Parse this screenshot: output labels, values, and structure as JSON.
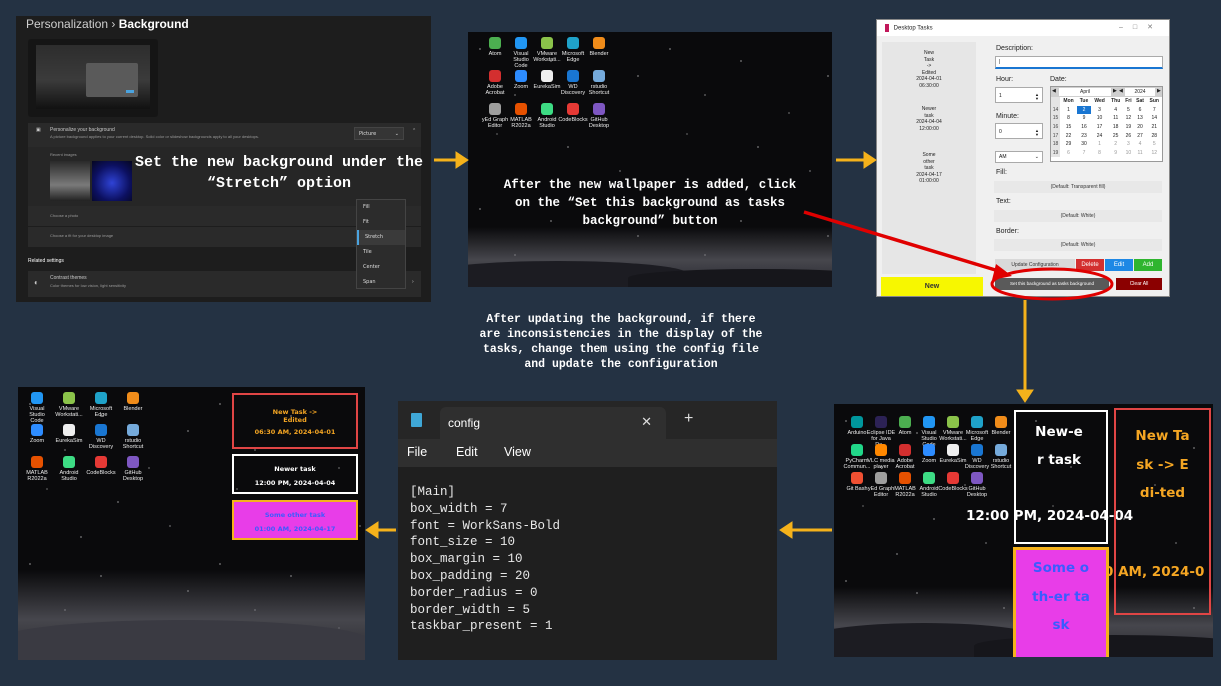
{
  "colors": {
    "background": "#243243",
    "arrow": "#f5b21b",
    "highlight": "#e00000"
  },
  "panel1": {
    "breadcrumb_parent": "Personalization",
    "breadcrumb_sep": "›",
    "breadcrumb_current": "Background",
    "personalize_title": "Personalize your background",
    "personalize_desc": "A picture background applies to your current desktop. Solid color or slideshow backgrounds apply to all your desktops.",
    "bg_type_value": "Picture",
    "recent_images": "Recent images",
    "choose_photo": "Choose a photo",
    "choose_fit": "Choose a fit for your desktop image",
    "related_settings": "Related settings",
    "contrast_title": "Contrast themes",
    "contrast_desc": "Color themes for low vision, light sensitivity",
    "fit_options": [
      "Fill",
      "Fit",
      "Stretch",
      "Tile",
      "Center",
      "Span"
    ],
    "fit_selected": "Stretch",
    "caption": "Set the new background under the “Stretch” option"
  },
  "panel2": {
    "icons": [
      {
        "label": "Atom",
        "color": "#4caf50"
      },
      {
        "label": "Visual Studio Code",
        "color": "#2196f3"
      },
      {
        "label": "VMware Workstati...",
        "color": "#8bc34a"
      },
      {
        "label": "Microsoft Edge",
        "color": "#1fa2c9"
      },
      {
        "label": "Blender",
        "color": "#f08c1a"
      },
      {
        "label": "Adobe Acrobat",
        "color": "#d32f2f"
      },
      {
        "label": "Zoom",
        "color": "#2d8cff"
      },
      {
        "label": "EurekaSim",
        "color": "#eeeeee"
      },
      {
        "label": "WD Discovery",
        "color": "#1976d2"
      },
      {
        "label": "rstudio Shortcut",
        "color": "#75aadb"
      },
      {
        "label": "yEd Graph Editor",
        "color": "#9e9e9e"
      },
      {
        "label": "MATLAB R2022a",
        "color": "#e65100"
      },
      {
        "label": "Android Studio",
        "color": "#3ddc84"
      },
      {
        "label": "CodeBlocks",
        "color": "#e53935"
      },
      {
        "label": "GitHub Desktop",
        "color": "#7e57c2"
      }
    ],
    "caption": "After the new wallpaper is added, click on the “Set this background as tasks background” button"
  },
  "panel3": {
    "window_title": "Desktop Tasks",
    "tasks": [
      {
        "lines": [
          "New",
          "Task",
          "->",
          "Edited",
          "2024-04-01",
          "06:30:00"
        ]
      },
      {
        "lines": [
          "Newer",
          "task",
          "2024-04-04",
          "12:00:00"
        ]
      },
      {
        "lines": [
          "Some",
          "other",
          "task",
          "2024-04-17",
          "01:00:00"
        ]
      }
    ],
    "new_button": "New",
    "description_label": "Description:",
    "description_value": "|",
    "hour_label": "Hour:",
    "hour_value": "1",
    "minute_label": "Minute:",
    "minute_value": "0",
    "ampm_value": "AM",
    "date_label": "Date:",
    "calendar_month": "April",
    "calendar_year": "2024",
    "calendar_days": [
      "Mon",
      "Tue",
      "Wed",
      "Thu",
      "Fri",
      "Sat",
      "Sun"
    ],
    "calendar_rows": [
      {
        "week": "14",
        "days": [
          "1",
          "2",
          "3",
          "4",
          "5",
          "6",
          "7"
        ]
      },
      {
        "week": "15",
        "days": [
          "8",
          "9",
          "10",
          "11",
          "12",
          "13",
          "14"
        ]
      },
      {
        "week": "16",
        "days": [
          "15",
          "16",
          "17",
          "18",
          "19",
          "20",
          "21"
        ]
      },
      {
        "week": "17",
        "days": [
          "22",
          "23",
          "24",
          "25",
          "26",
          "27",
          "28"
        ]
      },
      {
        "week": "18",
        "days": [
          "29",
          "30",
          "1",
          "2",
          "3",
          "4",
          "5"
        ]
      },
      {
        "week": "19",
        "days": [
          "6",
          "7",
          "8",
          "9",
          "10",
          "11",
          "12"
        ]
      }
    ],
    "calendar_selected": "2",
    "fill_label": "Fill:",
    "fill_value": "(Default: Transparent fill)",
    "text_label": "Text:",
    "text_value": "(Default: White)",
    "border_label": "Border:",
    "border_value": "(Default: White)",
    "update_config_button": "Update Configuration",
    "delete_button": "Delete",
    "edit_button": "Edit",
    "add_button": "Add",
    "set_bg_button": "Set this background as tasks background",
    "clear_all_button": "Clear All"
  },
  "panel4": {
    "icons": [
      {
        "label": "Arduino",
        "color": "#00979d"
      },
      {
        "label": "Eclipse IDE for Java De...",
        "color": "#2c2255"
      },
      {
        "label": "Atom",
        "color": "#4caf50"
      },
      {
        "label": "Visual Studio Code",
        "color": "#2196f3"
      },
      {
        "label": "VMware Workstati...",
        "color": "#8bc34a"
      },
      {
        "label": "Microsoft Edge",
        "color": "#1fa2c9"
      },
      {
        "label": "Blender",
        "color": "#f08c1a"
      },
      {
        "label": "PyCharm Commun...",
        "color": "#21d789"
      },
      {
        "label": "VLC media player",
        "color": "#ff8800"
      },
      {
        "label": "Adobe Acrobat",
        "color": "#d32f2f"
      },
      {
        "label": "Zoom",
        "color": "#2d8cff"
      },
      {
        "label": "EurekaSim",
        "color": "#eeeeee"
      },
      {
        "label": "WD Discovery",
        "color": "#1976d2"
      },
      {
        "label": "rstudio Shortcut",
        "color": "#75aadb"
      },
      {
        "label": "Git Bash",
        "color": "#f05032"
      },
      {
        "label": "yEd Graph Editor",
        "color": "#9e9e9e"
      },
      {
        "label": "MATLAB R2022a",
        "color": "#e65100"
      },
      {
        "label": "Android Studio",
        "color": "#3ddc84"
      },
      {
        "label": "CodeBlocks",
        "color": "#e53935"
      },
      {
        "label": "GitHub Desktop",
        "color": "#7e57c2"
      }
    ],
    "box_newer": "New-er task",
    "box_newer_time": "12:00 PM, 2024-04-04",
    "box_new_edited": "New Task -> Edi-ted",
    "box_new_edited_time": "0 AM, 2024-0",
    "box_some": "Some oth-er task"
  },
  "panel5": {
    "tab_title": "config",
    "tab_close": "✕",
    "tab_add": "+",
    "menu": [
      "File",
      "Edit",
      "View"
    ],
    "code_lines": [
      "[Main]",
      "box_width = 7",
      "font = WorkSans-Bold",
      "font_size = 10",
      "box_margin = 10",
      "box_padding = 20",
      "border_radius = 0",
      "border_width = 5",
      "taskbar_present = 1"
    ]
  },
  "panel6": {
    "icons": [
      {
        "label": "Visual Studio Code",
        "color": "#2196f3"
      },
      {
        "label": "VMware Workstati...",
        "color": "#8bc34a"
      },
      {
        "label": "Microsoft Edge",
        "color": "#1fa2c9"
      },
      {
        "label": "Blender",
        "color": "#f08c1a"
      },
      {
        "label": "Zoom",
        "color": "#2d8cff"
      },
      {
        "label": "EurekaSim",
        "color": "#eeeeee"
      },
      {
        "label": "WD Discovery",
        "color": "#1976d2"
      },
      {
        "label": "rstudio Shortcut",
        "color": "#75aadb"
      },
      {
        "label": "MATLAB R2022a",
        "color": "#e65100"
      },
      {
        "label": "Android Studio",
        "color": "#3ddc84"
      },
      {
        "label": "CodeBlocks",
        "color": "#e53935"
      },
      {
        "label": "GitHub Desktop",
        "color": "#7e57c2"
      }
    ],
    "task1_title": "New Task -> Edited",
    "task1_time": "06:30 AM, 2024-04-01",
    "task2_title": "Newer task",
    "task2_time": "12:00 PM, 2024-04-04",
    "task3_title": "Some other task",
    "task3_time": "01:00 AM, 2024-04-17"
  },
  "caption_middle": "After updating the background, if there are inconsistencies in the display of the tasks, change them using the config file and update the configuration"
}
